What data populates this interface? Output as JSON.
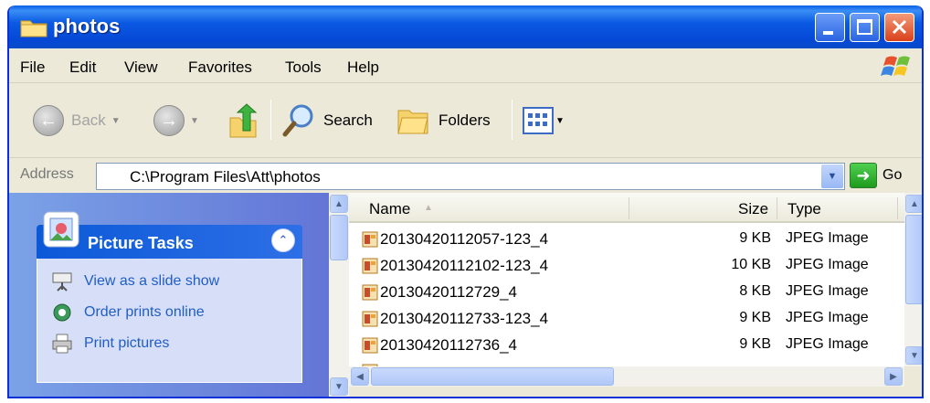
{
  "window": {
    "title": "photos"
  },
  "menu": [
    "File",
    "Edit",
    "View",
    "Favorites",
    "Tools",
    "Help"
  ],
  "toolbar": {
    "back_label": "Back",
    "search_label": "Search",
    "folders_label": "Folders"
  },
  "address": {
    "label": "Address",
    "value": "C:\\Program Files\\Att\\photos",
    "go_label": "Go"
  },
  "tasks": {
    "title": "Picture Tasks",
    "items": [
      {
        "label": "View as a slide show",
        "icon": "slideshow-icon"
      },
      {
        "label": "Order prints online",
        "icon": "order-prints-icon"
      },
      {
        "label": "Print pictures",
        "icon": "printer-icon"
      }
    ]
  },
  "files": {
    "columns": {
      "name": "Name",
      "size": "Size",
      "type": "Type"
    },
    "rows": [
      {
        "name": "20130420112057-123_4",
        "size": "9 KB",
        "type": "JPEG Image"
      },
      {
        "name": "20130420112102-123_4",
        "size": "10 KB",
        "type": "JPEG Image"
      },
      {
        "name": "20130420112729_4",
        "size": "8 KB",
        "type": "JPEG Image"
      },
      {
        "name": "20130420112733-123_4",
        "size": "9 KB",
        "type": "JPEG Image"
      },
      {
        "name": "20130420112736_4",
        "size": "9 KB",
        "type": "JPEG Image"
      }
    ]
  },
  "colors": {
    "titlebar": "#0548d6",
    "taskpane": "#7ba2e7",
    "link": "#215dc6"
  }
}
